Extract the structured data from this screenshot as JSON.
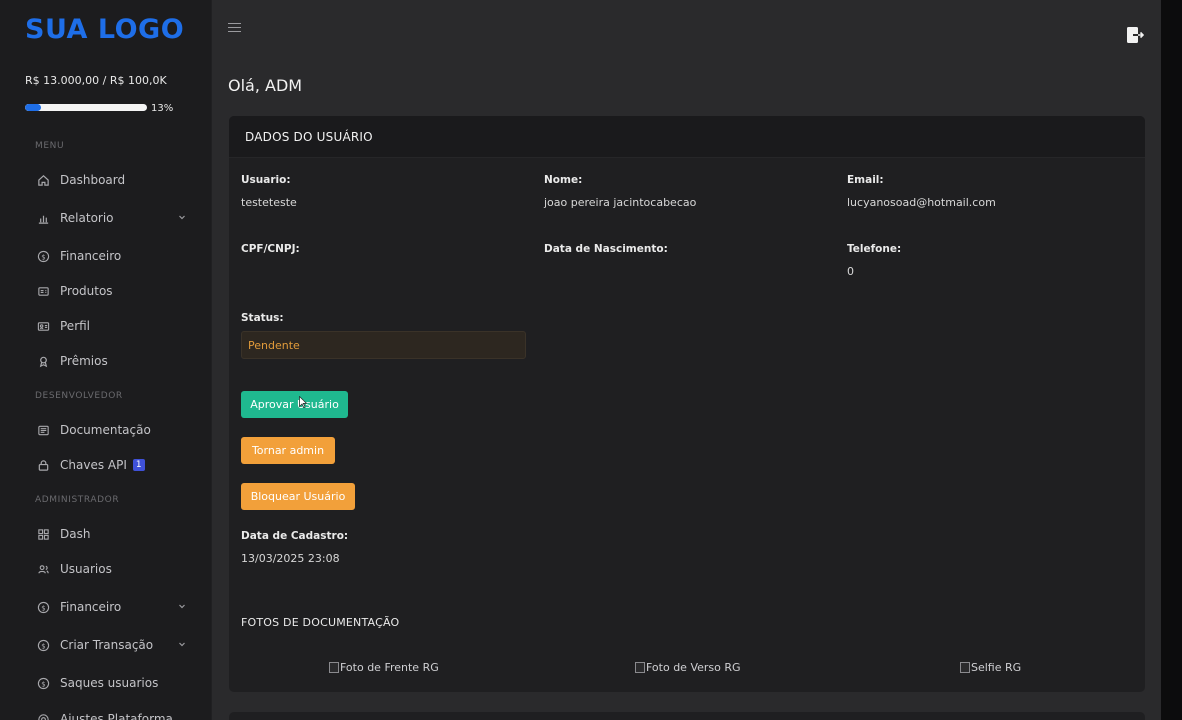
{
  "brand": {
    "logo_text": "SUA LOGO",
    "accent": "#1e6ee8"
  },
  "balance": {
    "text": "R$ 13.000,00 / R$ 100,0K",
    "progress_fraction": 0.13,
    "progress_label": "13%"
  },
  "sidebar": {
    "sections": {
      "menu": "MENU",
      "dev": "DESENVOLVEDOR",
      "admin": "ADMINISTRADOR"
    },
    "items": [
      {
        "label": "Dashboard",
        "icon": "home-icon"
      },
      {
        "label": "Relatorio",
        "icon": "bar-chart-icon",
        "has_chevron": true
      },
      {
        "label": "Financeiro",
        "icon": "dollar-circle-icon"
      },
      {
        "label": "Produtos",
        "icon": "product-icon"
      },
      {
        "label": "Perfil",
        "icon": "id-card-icon"
      },
      {
        "label": "Prêmios",
        "icon": "award-icon"
      },
      {
        "label": "Documentação",
        "icon": "document-icon"
      },
      {
        "label": "Chaves API",
        "icon": "lock-icon",
        "badge": "1"
      },
      {
        "label": "Dash",
        "icon": "grid-icon"
      },
      {
        "label": "Usuarios",
        "icon": "users-icon"
      },
      {
        "label": "Financeiro",
        "icon": "dollar-circle-icon",
        "has_chevron": true
      },
      {
        "label": "Criar Transação",
        "icon": "dollar-circle-icon",
        "has_chevron": true
      },
      {
        "label": "Saques usuarios",
        "icon": "dollar-circle-icon"
      },
      {
        "label": "Ajustes Plataforma",
        "icon": "settings-icon"
      }
    ]
  },
  "header": {
    "greeting": "Olá, ADM"
  },
  "card": {
    "title": "DADOS DO USUÁRIO",
    "fields": {
      "usuario": {
        "label": "Usuario:",
        "value": "testeteste"
      },
      "nome": {
        "label": "Nome:",
        "value": "joao pereira jacintocabecao"
      },
      "email": {
        "label": "Email:",
        "value": "lucyanosoad@hotmail.com"
      },
      "cpf": {
        "label": "CPF/CNPJ:",
        "value": ""
      },
      "nascimento": {
        "label": "Data de Nascimento:",
        "value": ""
      },
      "telefone": {
        "label": "Telefone:",
        "value": "0"
      },
      "status": {
        "label": "Status:",
        "value": "Pendente"
      },
      "cadastro": {
        "label": "Data de Cadastro:",
        "value": "13/03/2025 23:08"
      }
    },
    "buttons": {
      "aprovar": "Aprovar Usuário",
      "admin": "Tornar admin",
      "bloquear": "Bloquear Usuário"
    },
    "docs": {
      "title": "FOTOS DE DOCUMENTAÇÃO",
      "frente": "Foto de Frente RG",
      "verso": "Foto de Verso RG",
      "selfie": "Selfie RG"
    }
  },
  "colors": {
    "green": "#1fb88f",
    "orange": "#f2a03a",
    "status_text": "#e09a3a"
  }
}
